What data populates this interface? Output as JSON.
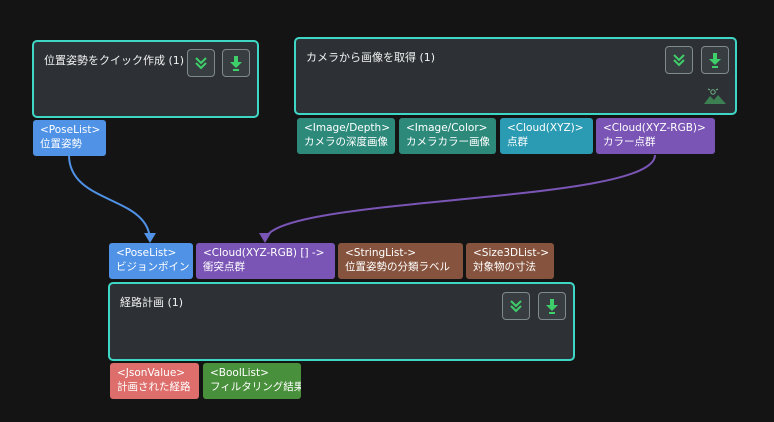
{
  "nodes": {
    "pose_node": {
      "title": "位置姿勢をクイック作成 (1)"
    },
    "camera_node": {
      "title": "カメラから画像を取得 (1)"
    },
    "path_node": {
      "title": "経路計画 (1)"
    }
  },
  "ports": {
    "pose_out": {
      "type": "<PoseList>",
      "name": "位置姿勢"
    },
    "cam_depth": {
      "type": "<Image/Depth>",
      "name": "カメラの深度画像"
    },
    "cam_color": {
      "type": "<Image/Color>",
      "name": "カメラカラー画像"
    },
    "cam_cloud": {
      "type": "<Cloud(XYZ)>",
      "name": "点群"
    },
    "cam_cloud_rgb": {
      "type": "<Cloud(XYZ-RGB)>",
      "name": "カラー点群"
    },
    "in_vision": {
      "type": "<PoseList>",
      "name": "ビジョンポイント"
    },
    "in_collision": {
      "type": "<Cloud(XYZ-RGB) [] ->",
      "name": "衝突点群"
    },
    "in_labels": {
      "type": "<StringList->",
      "name": "位置姿勢の分類ラベル"
    },
    "in_size": {
      "type": "<Size3DList->",
      "name": "対象物の寸法"
    },
    "out_path": {
      "type": "<JsonValue>",
      "name": "計画された経路"
    },
    "out_filter": {
      "type": "<BoolList>",
      "name": "フィルタリング結果"
    }
  },
  "icons": {
    "collapse": "chevron-double-down-icon",
    "run": "download-arrow-icon",
    "camera": "camera-landscape-icon"
  },
  "colors": {
    "node_border": "#3ed6c4",
    "node_bg": "#2d3135",
    "wire_pose": "#4f92e6",
    "wire_cloud": "#7a55b6",
    "icon_green": "#3fcf6a"
  }
}
